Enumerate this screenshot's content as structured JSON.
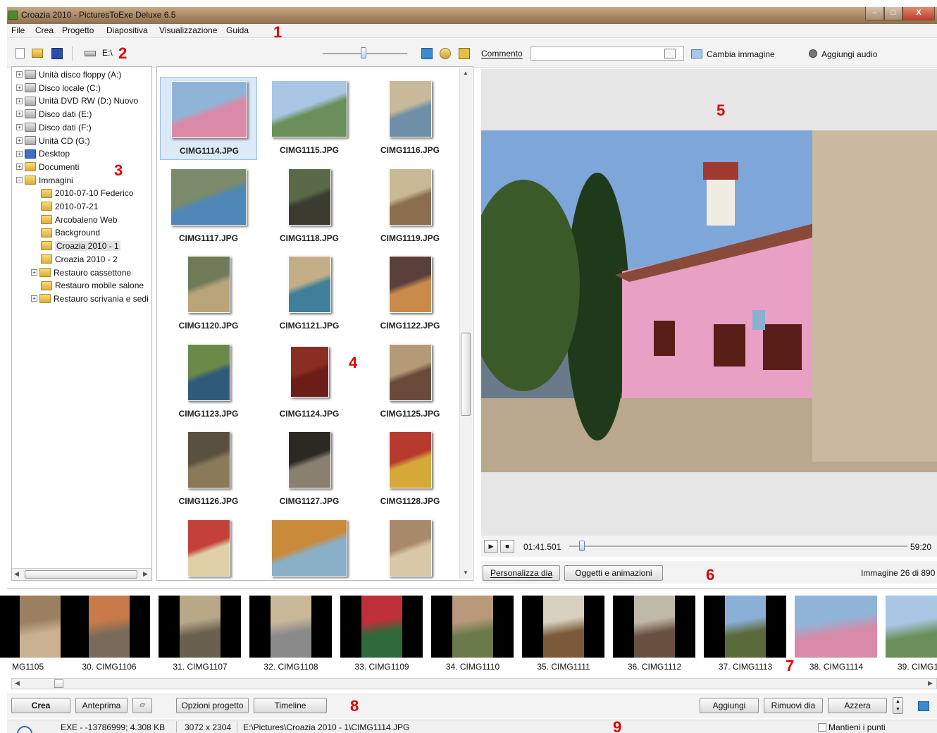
{
  "window": {
    "title": "Croazia 2010 - PicturesToExe Deluxe 6.5"
  },
  "menu": [
    "File",
    "Crea",
    "Progetto",
    "Diapositiva",
    "Visualizzazione",
    "Guida"
  ],
  "toolbar": {
    "drive_label": "E:\\",
    "comment_label": "Commento",
    "comment_value": "",
    "change_image": "Cambia immagine",
    "add_audio": "Aggiungi audio",
    "zoom_level": 0.45
  },
  "tree": [
    {
      "label": "Unità disco floppy (A:)",
      "kind": "drive",
      "level": 0,
      "expander": "+"
    },
    {
      "label": "Disco locale (C:)",
      "kind": "drive",
      "level": 0,
      "expander": "+"
    },
    {
      "label": "Unità DVD RW (D:) Nuovo",
      "kind": "drive",
      "level": 0,
      "expander": "+"
    },
    {
      "label": "Disco dati (E:)",
      "kind": "drive",
      "level": 0,
      "expander": "+"
    },
    {
      "label": "Disco dati (F:)",
      "kind": "drive",
      "level": 0,
      "expander": "+"
    },
    {
      "label": "Unità CD (G:)",
      "kind": "drive",
      "level": 0,
      "expander": "+"
    },
    {
      "label": "Desktop",
      "kind": "desktop",
      "level": 0,
      "expander": "+"
    },
    {
      "label": "Documenti",
      "kind": "folder",
      "level": 0,
      "expander": "+"
    },
    {
      "label": "Immagini",
      "kind": "folder",
      "level": 0,
      "expander": "-"
    },
    {
      "label": "2010-07-10 Federico",
      "kind": "folder",
      "level": 1,
      "expander": ""
    },
    {
      "label": "2010-07-21",
      "kind": "folder",
      "level": 1,
      "expander": ""
    },
    {
      "label": "Arcobaleno Web",
      "kind": "folder",
      "level": 1,
      "expander": ""
    },
    {
      "label": "Background",
      "kind": "folder",
      "level": 1,
      "expander": ""
    },
    {
      "label": "Croazia 2010 - 1",
      "kind": "folder",
      "level": 1,
      "expander": "",
      "selected": true
    },
    {
      "label": "Croazia 2010 - 2",
      "kind": "folder",
      "level": 1,
      "expander": ""
    },
    {
      "label": "Restauro cassettone",
      "kind": "folder",
      "level": 1,
      "expander": "+"
    },
    {
      "label": "Restauro mobile salone",
      "kind": "folder",
      "level": 1,
      "expander": ""
    },
    {
      "label": "Restauro scrivania e sedi",
      "kind": "folder",
      "level": 1,
      "expander": "+"
    }
  ],
  "thumbnails": [
    {
      "name": "CIMG1114.JPG",
      "orient": "land",
      "selected": true,
      "c1": "#8fb4d8",
      "c2": "#d98aa9"
    },
    {
      "name": "CIMG1115.JPG",
      "orient": "land",
      "c1": "#a9c7e4",
      "c2": "#6a8f5a"
    },
    {
      "name": "CIMG1116.JPG",
      "orient": "port",
      "c1": "#c8b99a",
      "c2": "#6f8fa8"
    },
    {
      "name": "CIMG1117.JPG",
      "orient": "land",
      "c1": "#7a8a6a",
      "c2": "#4f88b8"
    },
    {
      "name": "CIMG1118.JPG",
      "orient": "port",
      "c1": "#5a6a48",
      "c2": "#3b3b30"
    },
    {
      "name": "CIMG1119.JPG",
      "orient": "port",
      "c1": "#c9b894",
      "c2": "#8a6e4e"
    },
    {
      "name": "CIMG1120.JPG",
      "orient": "port",
      "c1": "#6f7a58",
      "c2": "#b9a37a"
    },
    {
      "name": "CIMG1121.JPG",
      "orient": "port",
      "c1": "#c4ae88",
      "c2": "#3f7f9a"
    },
    {
      "name": "CIMG1122.JPG",
      "orient": "port",
      "c1": "#5a3f3a",
      "c2": "#c98a4a"
    },
    {
      "name": "CIMG1123.JPG",
      "orient": "port",
      "c1": "#6a8a4a",
      "c2": "#2f5a7a"
    },
    {
      "name": "CIMG1124.JPG",
      "orient": "portsm",
      "c1": "#8a2e24",
      "c2": "#6b1e18"
    },
    {
      "name": "CIMG1125.JPG",
      "orient": "port",
      "c1": "#b59a78",
      "c2": "#6a4a3a"
    },
    {
      "name": "CIMG1126.JPG",
      "orient": "port",
      "c1": "#5a5040",
      "c2": "#8a7a5a"
    },
    {
      "name": "CIMG1127.JPG",
      "orient": "port",
      "c1": "#2a2a22",
      "c2": "#8a8070"
    },
    {
      "name": "CIMG1128.JPG",
      "orient": "port",
      "c1": "#b83a2e",
      "c2": "#d6a838"
    },
    {
      "name": "",
      "orient": "port",
      "c1": "#c4413a",
      "c2": "#e0d0a8"
    },
    {
      "name": "",
      "orient": "land",
      "c1": "#c98a3a",
      "c2": "#8ab0c8"
    },
    {
      "name": "",
      "orient": "port",
      "c1": "#a88a6a",
      "c2": "#d8c8a8"
    }
  ],
  "preview": {
    "playhead": "01:41.501",
    "total": "59:20",
    "progress": 0.02
  },
  "slide_buttons": {
    "customize": "Personalizza dia",
    "objects": "Oggetti e animazioni"
  },
  "image_counter": "Immagine 26 di 890",
  "filmstrip": [
    {
      "caption": "MG1105",
      "c1": "#9a8060",
      "c2": "#c8b090"
    },
    {
      "caption": "30. CIMG1106",
      "c1": "#c87a4a",
      "c2": "#7a6a5a"
    },
    {
      "caption": "31. CIMG1107",
      "c1": "#b8a888",
      "c2": "#6a6050"
    },
    {
      "caption": "32. CIMG1108",
      "c1": "#c8b898",
      "c2": "#8a8a8a"
    },
    {
      "caption": "33. CIMG1109",
      "c1": "#c0303a",
      "c2": "#2e6a3a"
    },
    {
      "caption": "34. CIMG1110",
      "c1": "#b89a7a",
      "c2": "#6a7a4a"
    },
    {
      "caption": "35. CIMG1111",
      "c1": "#d8d0c0",
      "c2": "#7a5a3a"
    },
    {
      "caption": "36. CIMG1112",
      "c1": "#c0b8a8",
      "c2": "#6a5040"
    },
    {
      "caption": "37. CIMG1113",
      "c1": "#8ab0d8",
      "c2": "#5a6a3a"
    },
    {
      "caption": "38. CIMG1114",
      "c1": "#8fb4d8",
      "c2": "#d98aa9"
    },
    {
      "caption": "39. CIMG1",
      "c1": "#a9c7e4",
      "c2": "#6a8f5a"
    }
  ],
  "bottom_buttons": {
    "create": "Crea",
    "preview": "Anteprima",
    "project_options": "Opzioni progetto",
    "timeline": "Timeline",
    "add": "Aggiungi",
    "remove": "Rimuovi dia",
    "reset": "Azzera"
  },
  "status": {
    "exe": "EXE - -13786999; 4.308 KB",
    "dims": "3072 x 2304",
    "path": "E:\\Pictures\\Croazia 2010 - 1\\CIMG1114.JPG",
    "keep_points": "Mantieni i punti"
  },
  "annotations": [
    "1",
    "2",
    "3",
    "4",
    "5",
    "6",
    "7",
    "8",
    "9"
  ]
}
